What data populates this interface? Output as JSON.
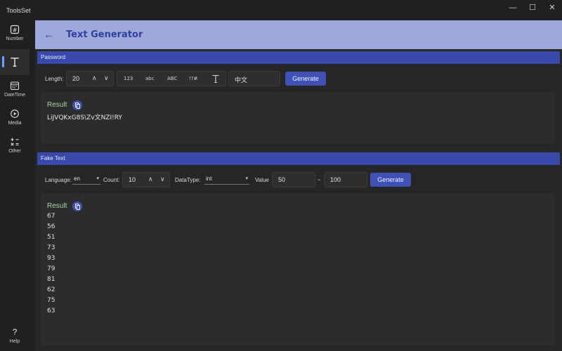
{
  "app": {
    "title": "ToolsSet"
  },
  "window": {
    "minimize": "—",
    "maximize": "☐",
    "close": "✕"
  },
  "nav": {
    "items": [
      {
        "label": "Number",
        "icon": "number-icon"
      },
      {
        "label": "",
        "icon": "text-icon"
      },
      {
        "label": "DateTime",
        "icon": "calendar-icon"
      },
      {
        "label": "Media",
        "icon": "media-icon"
      },
      {
        "label": "Other",
        "icon": "other-icon"
      }
    ],
    "help": "Help"
  },
  "header": {
    "back_glyph": "←",
    "title": "Text Generator"
  },
  "password": {
    "section_title": "Password",
    "length_label": "Length:",
    "length_value": "20",
    "toggles": [
      "123",
      "abc",
      "ABC",
      "!?#"
    ],
    "extra_chars": "中文",
    "generate_label": "Generate",
    "result_title": "Result",
    "result_value": "LiJVQKxG8S\\Zv文NZI!RY"
  },
  "fake_text": {
    "section_title": "Fake Text",
    "language_label": "Language:",
    "language_value": "en",
    "count_label": "Count:",
    "count_value": "10",
    "datatype_label": "DataType:",
    "datatype_value": "int",
    "value_label": "Value",
    "value_min": "50",
    "range_sep": "~",
    "value_max": "100",
    "generate_label": "Generate",
    "result_title": "Result",
    "result_values": [
      "67",
      "56",
      "51",
      "73",
      "93",
      "79",
      "81",
      "62",
      "75",
      "63"
    ]
  },
  "colors": {
    "accent": "#3f51b5",
    "header": "#9fa8da",
    "nav_active": "#60a8ff",
    "result_title": "#a5d6a7"
  }
}
